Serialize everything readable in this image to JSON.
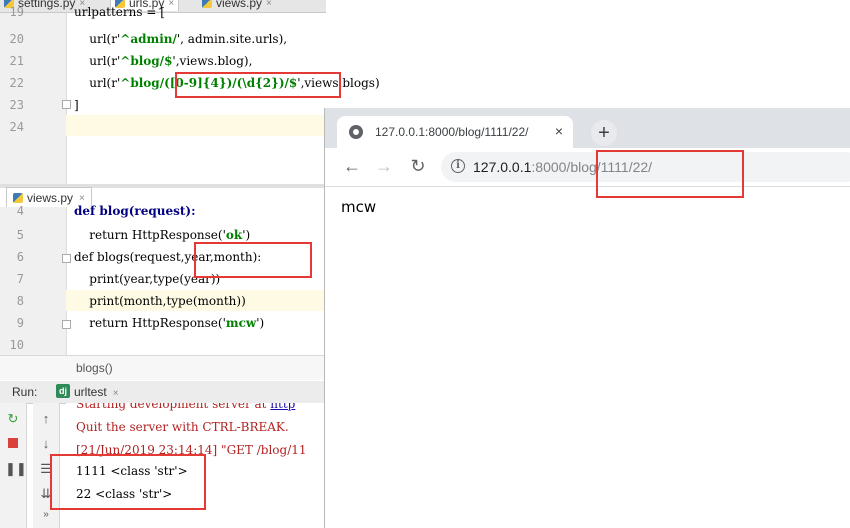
{
  "editor_tabs": [
    {
      "label": "settings.py",
      "close": "×"
    },
    {
      "label": "urls.py",
      "close": "×"
    },
    {
      "label": "views.py",
      "close": "×"
    }
  ],
  "urls_code": {
    "lines": [
      {
        "num": "19",
        "text": "urlpatterns = ["
      },
      {
        "num": "20",
        "pre": "    url(r'",
        "str": "^admin/",
        "post": "', admin.site.urls),"
      },
      {
        "num": "21",
        "pre": "    url(r'",
        "str": "^blog/$",
        "post": "',views.blog),"
      },
      {
        "num": "22",
        "pre": "    url(r'",
        "str": "^blog",
        "mid": "/([0-9]{4})/(\\d{2})/$",
        "post": "',views.blogs)"
      },
      {
        "num": "23",
        "text": "]"
      },
      {
        "num": "24",
        "text": ""
      }
    ]
  },
  "views_tab": {
    "label": "views.py",
    "close": "×"
  },
  "views_code": {
    "lines": [
      {
        "num": "4",
        "text": "def blog(request):"
      },
      {
        "num": "5",
        "pre": "    return HttpResponse('",
        "str": "ok",
        "post": "')"
      },
      {
        "num": "6",
        "text": "def blogs(request,year,month):"
      },
      {
        "num": "7",
        "text": "    print(year,type(year))"
      },
      {
        "num": "8",
        "text": "    print(month,type(month))"
      },
      {
        "num": "9",
        "pre": "    return HttpResponse('",
        "str": "mcw",
        "post": "')"
      },
      {
        "num": "10",
        "text": ""
      }
    ]
  },
  "breadcrumb": "blogs()",
  "run_panel": {
    "label": "Run:",
    "tab": "urltest",
    "tab_close": "×",
    "icon": "django-icon"
  },
  "console": {
    "line1_pre": "Starting development server at ",
    "line1_link": "http",
    "line2": "Quit the server with CTRL-BREAK.",
    "line3": "[21/Jun/2019 23:14:14] \"GET /blog/11",
    "line4": "1111 <class 'str'>",
    "line5": "22 <class 'str'>"
  },
  "browser": {
    "tab_title": "127.0.0.1:8000/blog/1111/22/",
    "tab_close": "×",
    "new_tab": "+",
    "back": "←",
    "forward": "→",
    "reload": "↻",
    "url_host": "127.0.0.1",
    "url_path": ":8000/blog/1111/22/",
    "info": "i",
    "page_text": "mcw"
  },
  "colors": {
    "annotation_red": "#e53935",
    "string_green": "#008000",
    "keyword_navy": "#000080"
  }
}
